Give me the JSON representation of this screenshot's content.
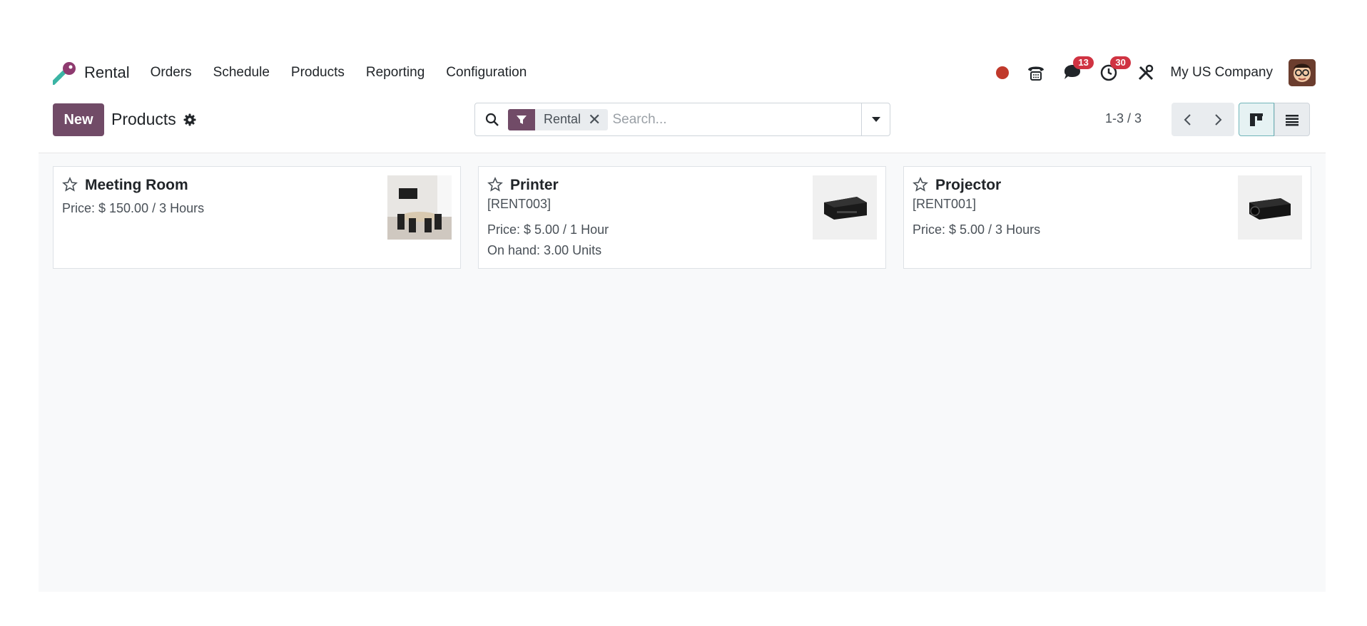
{
  "navbar": {
    "app_name": "Rental",
    "menu": [
      "Orders",
      "Schedule",
      "Products",
      "Reporting",
      "Configuration"
    ],
    "messages_count": "13",
    "activities_count": "30",
    "company": "My US Company"
  },
  "control_panel": {
    "new_label": "New",
    "breadcrumb": "Products",
    "facet_label": "Rental",
    "facet_close": "✕",
    "search_placeholder": "Search...",
    "pager": "1-3 / 3"
  },
  "cards": [
    {
      "name": "Meeting Room",
      "ref": "",
      "price": "Price: $ 150.00 / 3 Hours",
      "on_hand": ""
    },
    {
      "name": "Printer",
      "ref": "[RENT003]",
      "price": "Price: $ 5.00 / 1 Hour",
      "on_hand": "On hand: 3.00 Units"
    },
    {
      "name": "Projector",
      "ref": "[RENT001]",
      "price": "Price: $ 5.00 / 3 Hours",
      "on_hand": ""
    }
  ],
  "colors": {
    "brand": "#714b67",
    "badge": "#d03342",
    "record": "#c0392b",
    "kanban_active": "#e6f2f3"
  }
}
